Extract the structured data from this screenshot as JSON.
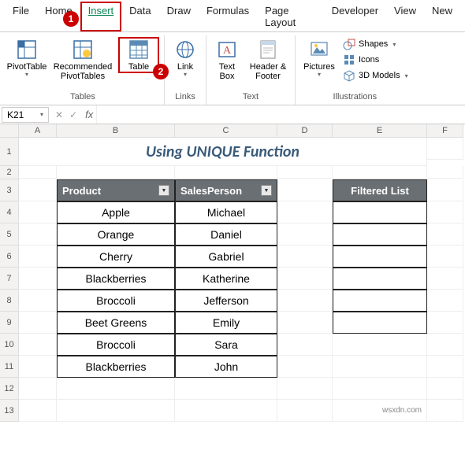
{
  "tabs": [
    "File",
    "Home",
    "Insert",
    "Data",
    "Draw",
    "Formulas",
    "Page Layout",
    "Developer",
    "View",
    "New"
  ],
  "active_tab": "Insert",
  "ribbon": {
    "tables": {
      "label": "Tables",
      "pivot": "PivotTable",
      "recommended": "Recommended PivotTables",
      "table": "Table"
    },
    "links": {
      "label": "Links",
      "link": "Link"
    },
    "text": {
      "label": "Text",
      "textbox": "Text Box",
      "header": "Header & Footer"
    },
    "illus": {
      "label": "Illustrations",
      "pictures": "Pictures",
      "shapes": "Shapes",
      "icons": "Icons",
      "models": "3D Models"
    }
  },
  "namebox": "K21",
  "columns": [
    "A",
    "B",
    "C",
    "D",
    "E",
    "F"
  ],
  "rows": [
    "1",
    "2",
    "3",
    "4",
    "5",
    "6",
    "7",
    "8",
    "9",
    "10",
    "11",
    "12",
    "13"
  ],
  "title": "Using UNIQUE Function",
  "table": {
    "headers": [
      "Product",
      "SalesPerson"
    ],
    "data": [
      [
        "Apple",
        "Michael"
      ],
      [
        "Orange",
        "Daniel"
      ],
      [
        "Cherry",
        "Gabriel"
      ],
      [
        "Blackberries",
        "Katherine"
      ],
      [
        "Broccoli",
        "Jefferson"
      ],
      [
        "Beet Greens",
        "Emily"
      ],
      [
        "Broccoli",
        "Sara"
      ],
      [
        "Blackberries",
        "John"
      ]
    ]
  },
  "filtered_header": "Filtered List",
  "watermark": "wsxdn.com",
  "badge1": "1",
  "badge2": "2"
}
